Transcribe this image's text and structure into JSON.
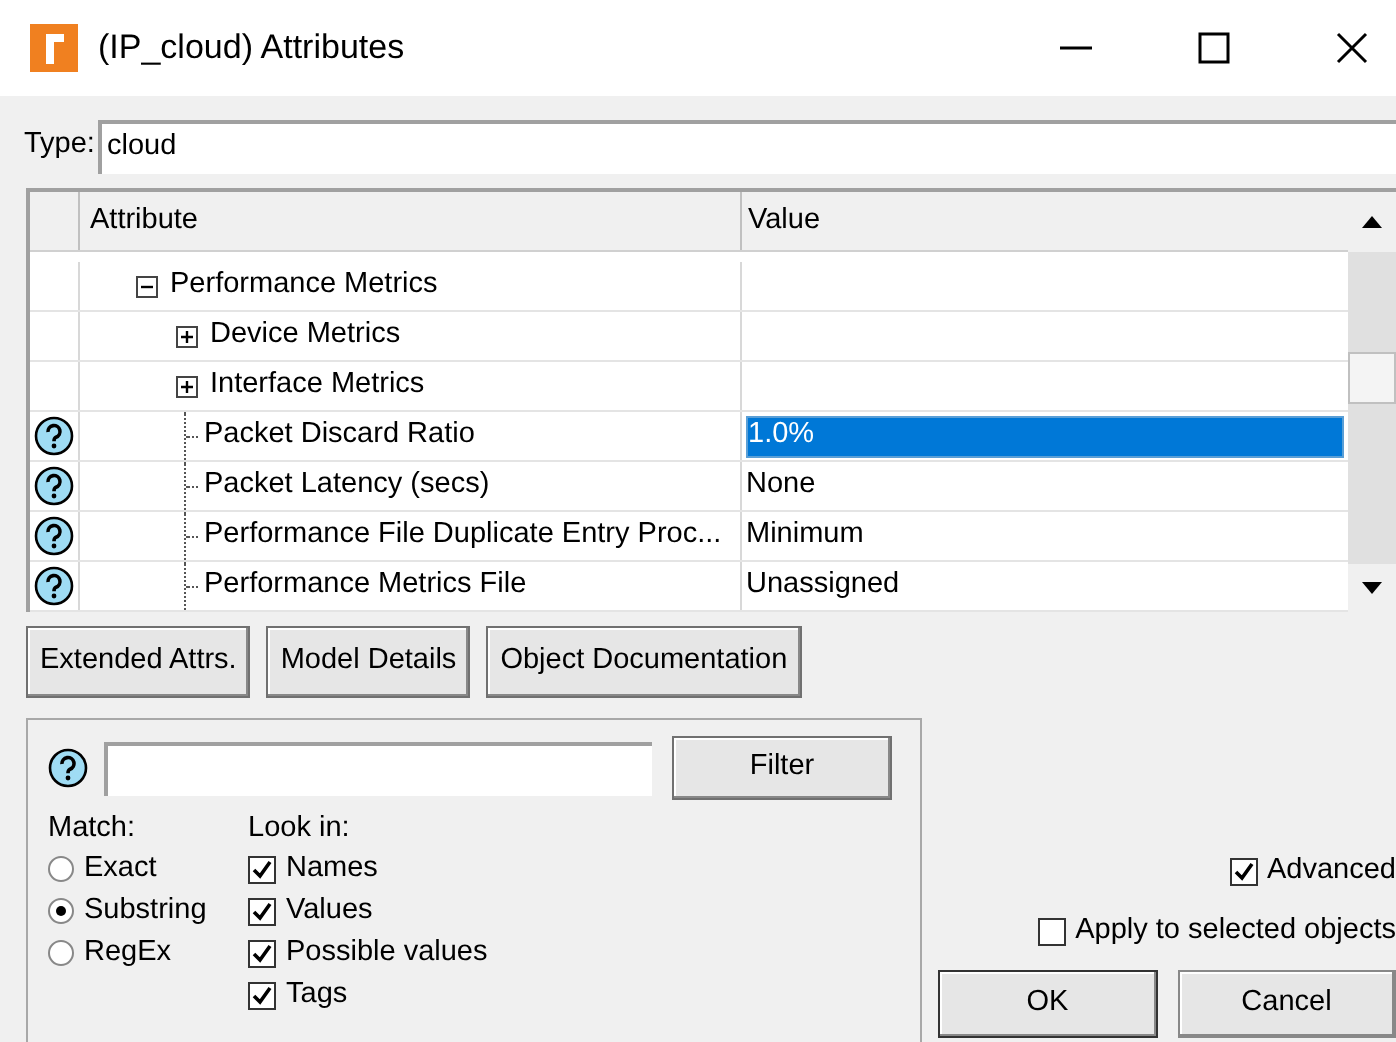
{
  "window": {
    "title": "(IP_cloud) Attributes"
  },
  "type_field": {
    "label": "Type:",
    "value": "cloud"
  },
  "table": {
    "columns": [
      "Attribute",
      "Value"
    ],
    "rows": [
      {
        "kind": "group",
        "label": "Performance Metrics",
        "expanded": true,
        "children": [
          {
            "kind": "group",
            "label": "Device Metrics",
            "expanded": false
          },
          {
            "kind": "group",
            "label": "Interface Metrics",
            "expanded": false
          },
          {
            "kind": "attribute",
            "label": "Packet Discard Ratio",
            "value": "1.0%",
            "selected": true
          },
          {
            "kind": "attribute",
            "label": "Packet Latency (secs)",
            "value": "None",
            "selected": false
          },
          {
            "kind": "attribute",
            "label": "Performance File Duplicate Entry Proc...",
            "value": "Minimum",
            "selected": false
          },
          {
            "kind": "attribute",
            "label": "Performance Metrics File",
            "value": "Unassigned",
            "selected": false
          }
        ]
      }
    ]
  },
  "buttons": [
    "Extended Attrs.",
    "Model Details",
    "Object Documentation"
  ],
  "filter": {
    "button": "Filter",
    "match_label": "Match:",
    "match_options": [
      {
        "label": "Exact",
        "selected": false
      },
      {
        "label": "Substring",
        "selected": true
      },
      {
        "label": "RegEx",
        "selected": false
      }
    ],
    "look_in_label": "Look in:",
    "look_in": [
      {
        "label": "Names",
        "checked": true
      },
      {
        "label": "Values",
        "checked": true
      },
      {
        "label": "Possible values",
        "checked": true
      },
      {
        "label": "Tags",
        "checked": true
      }
    ]
  },
  "advanced": {
    "label": "Advanced",
    "checked": true
  },
  "apply_selected": {
    "label": "Apply to selected objects",
    "checked": false
  },
  "dialog_buttons": [
    "OK",
    "Cancel"
  ]
}
